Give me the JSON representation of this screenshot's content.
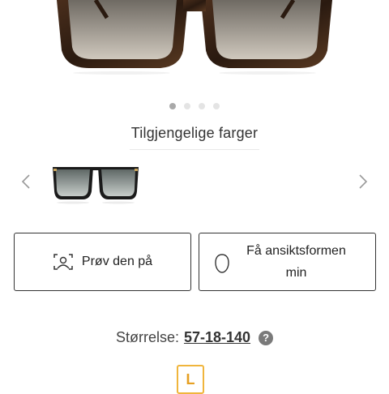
{
  "carousel": {
    "image_name": "sunglasses-front-view",
    "dots": [
      true,
      false,
      false,
      false
    ]
  },
  "colors": {
    "title": "Tilgjengelige farger",
    "swatch_name": "black-frame-swatch"
  },
  "actions": {
    "try_on_label": "Prøv den på",
    "face_shape_label": "Få ansiktsformen min"
  },
  "size": {
    "label": "Størrelse:",
    "value": "57-18-140",
    "help_icon": "?",
    "selected": "L"
  },
  "palette": {
    "frame_tortoise": "#3a2518",
    "lens_gradient_top": "#6f6a63",
    "lens_gradient_bottom": "#c9c2b6",
    "size_accent": "#f0b53c"
  }
}
